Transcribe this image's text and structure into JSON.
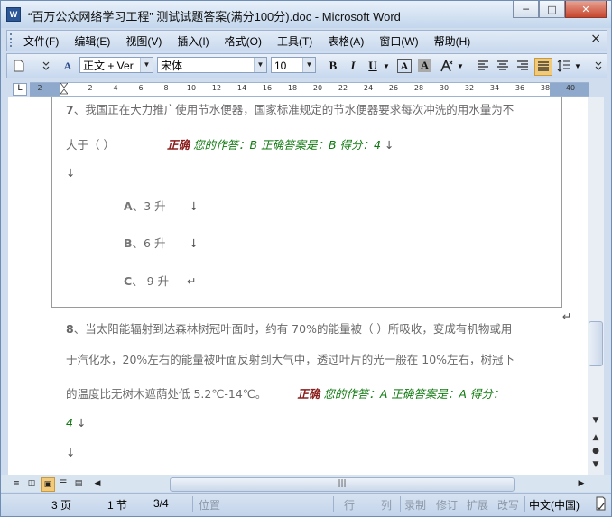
{
  "window": {
    "title": "“百万公众网络学习工程” 测试试题答案(满分100分).doc - Microsoft Word",
    "minimize": "─",
    "maximize": "□",
    "close": "✕"
  },
  "menu": {
    "items": [
      "文件(F)",
      "编辑(E)",
      "视图(V)",
      "插入(I)",
      "格式(O)",
      "工具(T)",
      "表格(A)",
      "窗口(W)",
      "帮助(H)"
    ],
    "close_doc": "×"
  },
  "toolbar": {
    "style_value": "正文 + Ver",
    "font_value": "宋体",
    "size_value": "10",
    "bold": "B",
    "italic": "I",
    "underline": "U",
    "char_border": "A",
    "char_shading": "A"
  },
  "ruler": {
    "marks": [
      "2",
      "2",
      "4",
      "6",
      "8",
      "10",
      "12",
      "14",
      "16",
      "18",
      "20",
      "22",
      "24",
      "26",
      "28",
      "30",
      "32",
      "34",
      "36",
      "38",
      "40"
    ],
    "tab_selector": "L"
  },
  "document": {
    "q7": {
      "number": "7",
      "line1": "、我国正在大力推广使用节水便器，国家标准规定的节水便器要求每次冲洗的用水量为不",
      "line2_prefix": "大于（  ）",
      "correct_label": "正确",
      "answer_text": "您的作答：B  正确答案是：B  得分：4",
      "options": [
        {
          "letter": "A",
          "text": "、3 升"
        },
        {
          "letter": "B",
          "text": "、6 升"
        },
        {
          "letter": "C",
          "text": "、 9 升"
        }
      ]
    },
    "q8": {
      "number": "8",
      "line1": "、当太阳能辐射到达森林树冠叶面时，约有 70%的能量被（  ）所吸收，变成有机物或用",
      "line2": "于汽化水，20%左右的能量被叶面反射到大气中，透过叶片的光一般在 10%左右，树冠下",
      "line3": "的温度比无树木遮荫处低 5.2℃-14℃。",
      "correct_label": "正确",
      "answer_text": "您的作答：A  正确答案是：A  得分：",
      "score_wrap": "4"
    },
    "para_mark": "↓",
    "return_mark": "↵"
  },
  "statusbar": {
    "page": "3 页",
    "section": "1 节",
    "page_of": "3/4",
    "position": "位置",
    "line": "行",
    "column": "列",
    "record": "录制",
    "revision": "修订",
    "extend": "扩展",
    "overwrite": "改写",
    "language": "中文(中国)"
  }
}
